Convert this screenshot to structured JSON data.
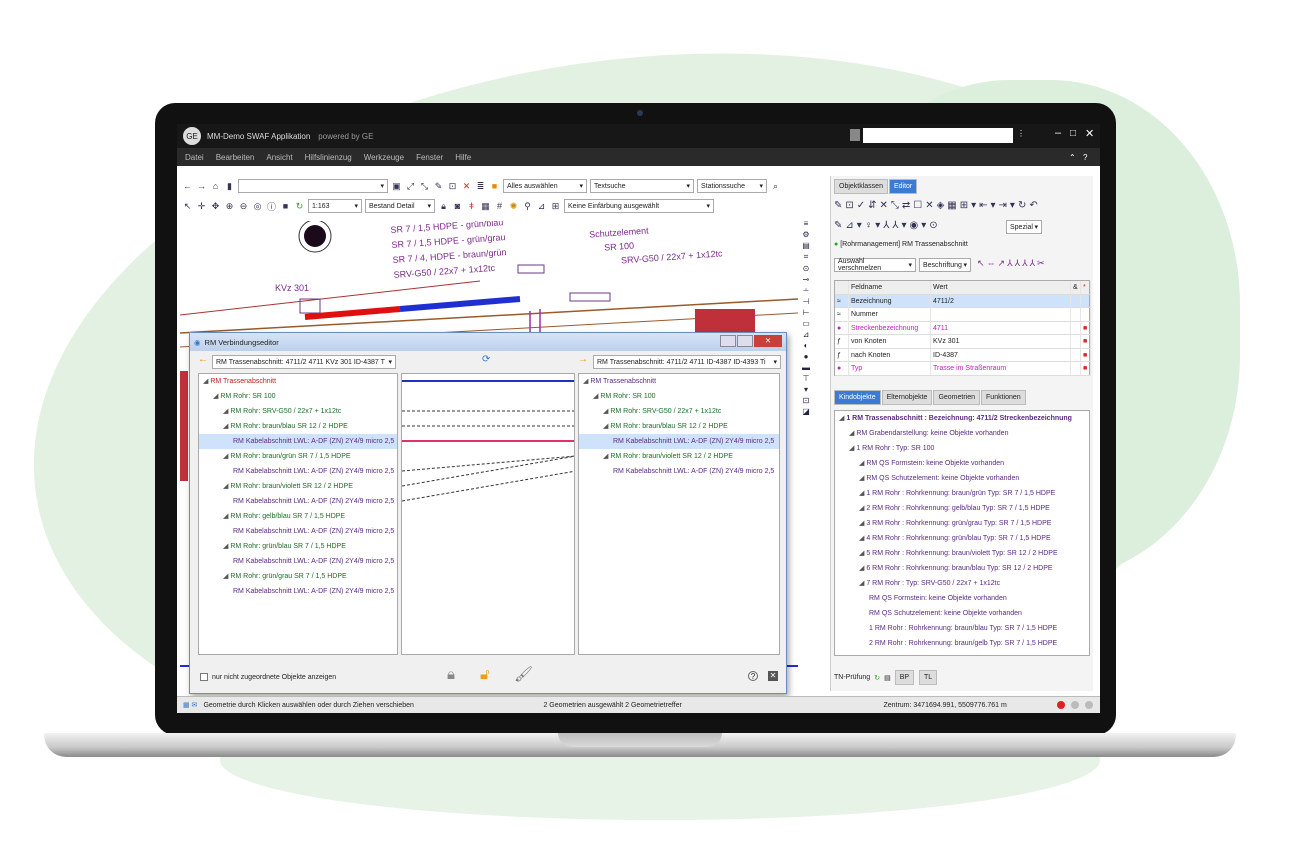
{
  "app": {
    "title": "MM-Demo SWAF Applikation",
    "powered": "powered by GE",
    "search_value": ""
  },
  "menu": [
    "Datei",
    "Bearbeiten",
    "Ansicht",
    "Hilfslinienzug",
    "Werkzeuge",
    "Fenster",
    "Hilfe"
  ],
  "toolbar": {
    "select_all": "Alles auswählen",
    "textsuche": "Textsuche",
    "stationssuche": "Stationssuche",
    "scale": "1:163",
    "bestand": "Bestand Detail",
    "einfaerbung": "Keine Einfärbung ausgewählt"
  },
  "map": {
    "labels": [
      "SR 7 / 1,5 HDPE - grün/blau",
      "SR 7 / 1,5 HDPE - grün/grau",
      "SR 7 / 4, HDPE - braun/grün",
      "SRV-G50 / 22x7 + 1x12tc",
      "Schutzelement",
      "SR 100",
      "SRV-G50 / 22x7 + 1x12tc",
      "KVz 301"
    ]
  },
  "dialog": {
    "title": "RM Verbindungseditor",
    "left_combo": "RM Trassenabschnitt: 4711/2 4711 KVz 301 ID-4387 T",
    "right_combo": "RM Trassenabschnitt: 4711/2 4711 ID-4387 ID-4393 Ti",
    "checkbox": "nur nicht zugeordnete Objekte anzeigen",
    "left_tree": [
      {
        "t": "RM Trassenabschnitt",
        "c": "red",
        "i": 0
      },
      {
        "t": "RM Rohr:  SR 100",
        "c": "green",
        "i": 1
      },
      {
        "t": "RM Rohr:  SRV-G50 / 22x7 + 1x12tc",
        "c": "green",
        "i": 2
      },
      {
        "t": "RM Rohr:  braun/blau SR 12 / 2 HDPE",
        "c": "green",
        "i": 2
      },
      {
        "t": "RM Kabelabschnitt LWL:  A-DF (ZN) 2Y4/9 micro 2,5",
        "c": "purple",
        "i": 3,
        "sel": true
      },
      {
        "t": "RM Rohr:  braun/grün SR 7 / 1,5 HDPE",
        "c": "green",
        "i": 2
      },
      {
        "t": "RM Kabelabschnitt LWL:  A-DF (ZN) 2Y4/9 micro 2,5",
        "c": "purple",
        "i": 3
      },
      {
        "t": "RM Rohr:  braun/violett SR 12 / 2 HDPE",
        "c": "green",
        "i": 2
      },
      {
        "t": "RM Kabelabschnitt LWL:  A-DF (ZN) 2Y4/9 micro 2,5",
        "c": "purple",
        "i": 3
      },
      {
        "t": "RM Rohr:  gelb/blau SR 7 / 1,5 HDPE",
        "c": "green",
        "i": 2
      },
      {
        "t": "RM Kabelabschnitt LWL:  A-DF (ZN) 2Y4/9 micro 2,5",
        "c": "purple",
        "i": 3
      },
      {
        "t": "RM Rohr:  grün/blau SR 7 / 1,5 HDPE",
        "c": "green",
        "i": 2
      },
      {
        "t": "RM Kabelabschnitt LWL:  A-DF (ZN) 2Y4/9 micro 2,5",
        "c": "purple",
        "i": 3
      },
      {
        "t": "RM Rohr:  grün/grau SR 7 / 1,5 HDPE",
        "c": "green",
        "i": 2
      },
      {
        "t": "RM Kabelabschnitt LWL:  A-DF (ZN) 2Y4/9 micro 2,5",
        "c": "purple",
        "i": 3
      }
    ],
    "right_tree": [
      {
        "t": "RM Trassenabschnitt",
        "c": "purple",
        "i": 0
      },
      {
        "t": "RM Rohr:  SR 100",
        "c": "green",
        "i": 1
      },
      {
        "t": "RM Rohr:  SRV-G50 / 22x7 + 1x12tc",
        "c": "green",
        "i": 2
      },
      {
        "t": "RM Rohr:  braun/blau SR 12 / 2 HDPE",
        "c": "green",
        "i": 2
      },
      {
        "t": "RM Kabelabschnitt LWL:  A-DF (ZN) 2Y4/9 micro 2,5",
        "c": "purple",
        "i": 3,
        "sel": true
      },
      {
        "t": "RM Rohr:  braun/violett SR 12 / 2 HDPE",
        "c": "green",
        "i": 2
      },
      {
        "t": "RM Kabelabschnitt LWL:  A-DF (ZN) 2Y4/9 micro 2,5",
        "c": "purple",
        "i": 3
      }
    ]
  },
  "editor": {
    "tabs": [
      "Objektklassen",
      "Editor"
    ],
    "context": "[Rohrmanagement] RM Trassenabschnitt",
    "auswahl": "Auswahl verschmelzen",
    "beschriftung": "Beschriftung",
    "spezial": "Spezial",
    "grid_head": [
      "Feldname",
      "Wert"
    ],
    "grid": [
      [
        "Bezeichnung",
        "4711/2"
      ],
      [
        "Nummer",
        ""
      ],
      [
        "Streckenbezeichnung",
        "4711"
      ],
      [
        "von Knoten",
        "KVz 301"
      ],
      [
        "nach Knoten",
        "ID-4387"
      ],
      [
        "Typ",
        "Trasse im Straßenraum"
      ]
    ],
    "subtabs": [
      "Kindobjekte",
      "Elternobjekte",
      "Geometrien",
      "Funktionen"
    ],
    "tree": [
      {
        "t": "1 RM Trassenabschnitt :  Bezeichnung: 4711/2 Streckenbezeichnung",
        "i": 0,
        "b": true
      },
      {
        "t": "RM Grabendarstellung: keine Objekte vorhanden",
        "i": 1
      },
      {
        "t": "1 RM Rohr :  Typ: SR 100",
        "i": 1
      },
      {
        "t": "RM QS Formstein: keine Objekte vorhanden",
        "i": 2
      },
      {
        "t": "RM QS Schutzelement: keine Objekte vorhanden",
        "i": 2
      },
      {
        "t": "1 RM Rohr :  Rohrkennung: braun/grün Typ: SR 7 / 1,5 HDPE",
        "i": 2
      },
      {
        "t": "2 RM Rohr :  Rohrkennung: gelb/blau Typ: SR 7 / 1,5 HDPE",
        "i": 2
      },
      {
        "t": "3 RM Rohr :  Rohrkennung: grün/grau Typ: SR 7 / 1,5 HDPE",
        "i": 2
      },
      {
        "t": "4 RM Rohr :  Rohrkennung: grün/blau Typ: SR 7 / 1,5 HDPE",
        "i": 2
      },
      {
        "t": "5 RM Rohr :  Rohrkennung: braun/violett Typ: SR 12 / 2 HDPE",
        "i": 2
      },
      {
        "t": "6 RM Rohr :  Rohrkennung: braun/blau Typ: SR 12 / 2 HDPE",
        "i": 2
      },
      {
        "t": "7 RM Rohr :  Typ: SRV-G50 / 22x7 + 1x12tc",
        "i": 2
      },
      {
        "t": "RM QS Formstein: keine Objekte vorhanden",
        "i": 3
      },
      {
        "t": "RM QS Schutzelement: keine Objekte vorhanden",
        "i": 3
      },
      {
        "t": "1 RM Rohr :  Rohrkennung: braun/blau Typ: SR 7 / 1,5 HDPE",
        "i": 3
      },
      {
        "t": "2 RM Rohr :  Rohrkennung: braun/gelb Typ: SR 7 / 1,5 HDPE",
        "i": 3
      }
    ],
    "tn": "TN-Prüfung",
    "bp": "BP",
    "tl": "TL"
  },
  "status": {
    "hint": "Geometrie durch Klicken auswählen oder durch Ziehen verschieben",
    "count": "2 Geometrien ausgewählt 2 Geometrietreffer",
    "center": "Zentrum: 3471694.991, 5509776.761 m"
  }
}
